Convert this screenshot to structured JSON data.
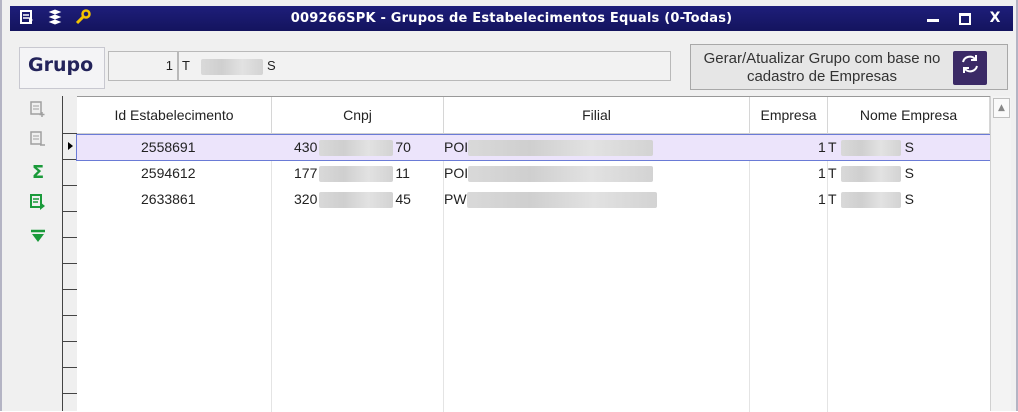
{
  "window": {
    "title": "009266SPK - Grupos de Estabelecimentos Equals (0-Todas)",
    "title_bg": "#14145e",
    "icons": [
      "form-icon",
      "layers-icon",
      "wrench-icon"
    ]
  },
  "header": {
    "grupo_label": "Grupo",
    "grupo_id": "1",
    "grupo_name_partial": "T",
    "grupo_name_end": "S",
    "gerar_button_label": "Gerar/Atualizar Grupo com base no cadastro de Empresas",
    "gerar_icon": "refresh-icon"
  },
  "toolbar": {
    "items": [
      "insert-row-icon",
      "delete-row-icon",
      "sum-icon",
      "export-icon",
      "filter-icon"
    ]
  },
  "grid": {
    "columns": [
      "Id Estabelecimento",
      "Cnpj",
      "Filial",
      "Empresa",
      "Nome Empresa"
    ],
    "rows": [
      {
        "id": "2558691",
        "cnpj_start": "430",
        "cnpj_end": "70",
        "filial": "POI",
        "empresa": "1",
        "nome_start": "T",
        "nome_end": "S",
        "selected": true
      },
      {
        "id": "2594612",
        "cnpj_start": "177",
        "cnpj_end": "11",
        "filial": "POI",
        "empresa": "1",
        "nome_start": "T",
        "nome_end": "S",
        "selected": false
      },
      {
        "id": "2633861",
        "cnpj_start": "320",
        "cnpj_end": "45",
        "filial": "PW",
        "empresa": "1",
        "nome_start": "T",
        "nome_end": "S",
        "selected": false
      }
    ],
    "selection_color": "#ece4fb"
  }
}
